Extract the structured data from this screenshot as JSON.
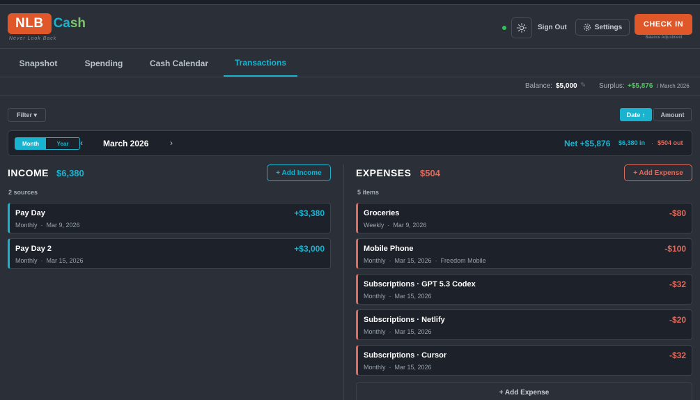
{
  "brand": {
    "logo_nlb": "NLB",
    "logo_ca": "Ca",
    "logo_sh": "sh",
    "tagline": "Never Look Back"
  },
  "header": {
    "sign_out": "Sign Out",
    "settings": "Settings",
    "check_in": "CHECK IN",
    "check_in_sub": "Balance Adjustment"
  },
  "tabs": [
    {
      "label": "Snapshot",
      "active": false
    },
    {
      "label": "Spending",
      "active": false
    },
    {
      "label": "Cash Calendar",
      "active": false
    },
    {
      "label": "Transactions",
      "active": true
    }
  ],
  "summary": {
    "balance_label": "Balance:",
    "balance": "$5,000",
    "surplus_label": "Surplus:",
    "surplus": "+$5,876",
    "surplus_period": "/ March 2026"
  },
  "controls": {
    "filter": "Filter ▾",
    "sort_date": "Date ↑",
    "sort_amount": "Amount"
  },
  "period": {
    "mode_month": "Month",
    "mode_year": "Year",
    "prev": "‹",
    "title": "March 2026",
    "next": "›",
    "net": "Net +$5,876",
    "in": "$6,380 in",
    "dot": "·",
    "out": "$504 out"
  },
  "income": {
    "title": "INCOME",
    "total": "$6,380",
    "add_label": "+ Add Income",
    "count": "2 sources",
    "items": [
      {
        "name": "Pay Day",
        "freq": "Monthly",
        "date": "Mar 9, 2026",
        "amount": "+$3,380"
      },
      {
        "name": "Pay Day 2",
        "freq": "Monthly",
        "date": "Mar 15, 2026",
        "amount": "+$3,000"
      }
    ]
  },
  "expenses": {
    "title": "EXPENSES",
    "total": "$504",
    "add_label": "+ Add Expense",
    "count": "5 items",
    "items": [
      {
        "name": "Groceries",
        "freq": "Weekly",
        "date": "Mar 9, 2026",
        "note": "",
        "amount": "-$80"
      },
      {
        "name": "Mobile Phone",
        "freq": "Monthly",
        "date": "Mar 15, 2026",
        "note": "Freedom Mobile",
        "amount": "-$100"
      },
      {
        "name": "Subscriptions · GPT 5.3 Codex",
        "freq": "Monthly",
        "date": "Mar 15, 2026",
        "note": "",
        "amount": "-$32"
      },
      {
        "name": "Subscriptions · Netlify",
        "freq": "Monthly",
        "date": "Mar 15, 2026",
        "note": "",
        "amount": "-$20"
      },
      {
        "name": "Subscriptions · Cursor",
        "freq": "Monthly",
        "date": "Mar 15, 2026",
        "note": "",
        "amount": "-$32"
      }
    ],
    "add_bottom_label": "+ Add Expense"
  },
  "colors": {
    "accent": "#1ab3cf",
    "brand_orange": "#e0582a",
    "income": "#1ab3cf",
    "expense": "#e06a5c",
    "surplus": "#4fc85e"
  },
  "icons": {
    "theme": "sun-icon",
    "settings": "gear-icon"
  }
}
